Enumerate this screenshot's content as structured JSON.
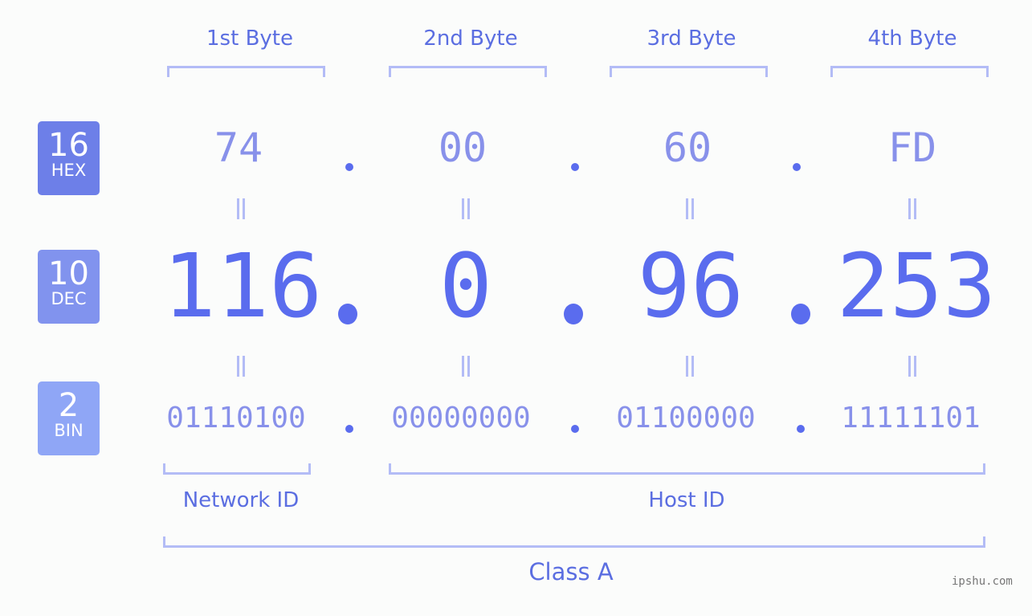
{
  "colors": {
    "hex_badge": "#6d7fe8",
    "dec_badge": "#8193ee",
    "bin_badge": "#8fa6f6",
    "accent": "#5a6cee",
    "bracket": "#b3bcf6"
  },
  "badges": [
    {
      "num": "16",
      "label": "HEX"
    },
    {
      "num": "10",
      "label": "DEC"
    },
    {
      "num": "2",
      "label": "BIN"
    }
  ],
  "byte_headers": [
    "1st Byte",
    "2nd Byte",
    "3rd Byte",
    "4th Byte"
  ],
  "hex": [
    "74",
    "00",
    "60",
    "FD"
  ],
  "dec": [
    "116",
    "0",
    "96",
    "253"
  ],
  "bin": [
    "01110100",
    "00000000",
    "01100000",
    "11111101"
  ],
  "equals_sign": "=",
  "labels": {
    "network": "Network ID",
    "host": "Host ID",
    "class": "Class A"
  },
  "watermark": "ipshu.com"
}
